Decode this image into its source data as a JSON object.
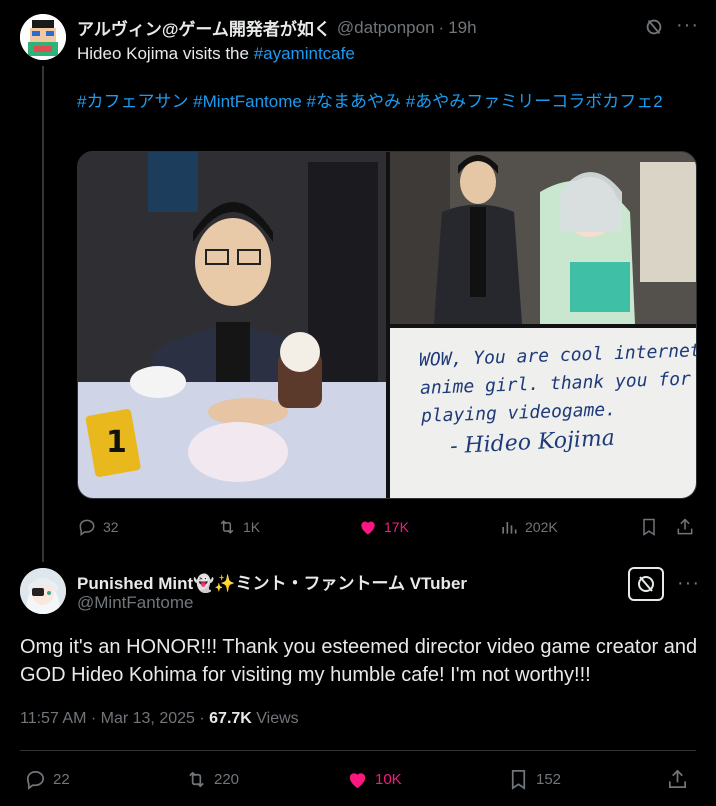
{
  "parent": {
    "display_name": "アルヴィン@ゲーム開発者が如く",
    "handle": "@datponpon",
    "time": "19h",
    "text_prefix": "Hideo Kojima visits the ",
    "text_link": "#ayamintcafe",
    "hashtags": "#カフェアサン #MintFantome #なまあやみ #あやみファミリーコラボカフェ2",
    "note": {
      "line1": "WOW, You are cool internet",
      "line2": "anime girl. thank you for",
      "line3": "playing videogame.",
      "signature": "- Hideo Kojima"
    },
    "stats": {
      "replies": "32",
      "reposts": "1K",
      "likes": "17K",
      "views": "202K"
    }
  },
  "reply": {
    "display_name": "Punished Mint👻✨ミント・ファントーム VTuber",
    "handle": "@MintFantome",
    "text": "Omg it's an HONOR!!! Thank you esteemed director video game creator and GOD Hideo Kohima for visiting my humble cafe! I'm not worthy!!!",
    "time": "11:57 AM · Mar 13, 2025 · ",
    "views_count": "67.7K",
    "views_label": " Views",
    "stats": {
      "replies": "22",
      "reposts": "220",
      "likes": "10K",
      "bookmarks": "152"
    }
  },
  "colors": {
    "accent": "#1d9bf0",
    "like": "#f91880",
    "muted": "#71767b",
    "text": "#e7e9ea",
    "background": "#000000"
  },
  "icons": [
    "grok-icon",
    "more-icon",
    "reply-icon",
    "repost-icon",
    "like-icon",
    "views-icon",
    "bookmark-icon",
    "share-icon"
  ]
}
